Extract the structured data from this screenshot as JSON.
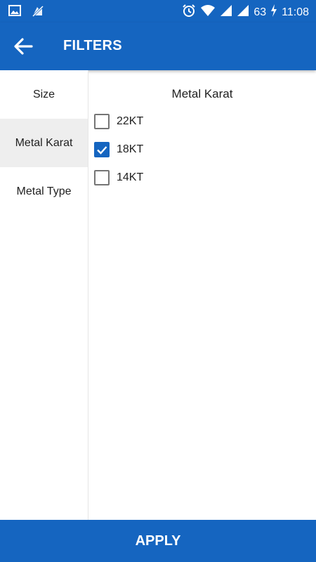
{
  "status_bar": {
    "battery": "63",
    "time": "11:08",
    "icons": [
      "image-icon",
      "notification-off-icon",
      "alarm-icon",
      "wifi-icon",
      "signal-icon",
      "signal-icon",
      "battery-charging-icon"
    ]
  },
  "app_bar": {
    "title": "FILTERS",
    "back_icon": "arrow-back-icon"
  },
  "sidebar": {
    "items": [
      {
        "label": "Size",
        "active": false
      },
      {
        "label": "Metal Karat",
        "active": true
      },
      {
        "label": "Metal Type",
        "active": false
      }
    ]
  },
  "content": {
    "title": "Metal Karat",
    "options": [
      {
        "label": "22KT",
        "checked": false
      },
      {
        "label": "18KT",
        "checked": true
      },
      {
        "label": "14KT",
        "checked": false
      }
    ]
  },
  "footer": {
    "apply_label": "APPLY"
  },
  "colors": {
    "primary": "#1565c0",
    "active_bg": "#eeeeee"
  }
}
